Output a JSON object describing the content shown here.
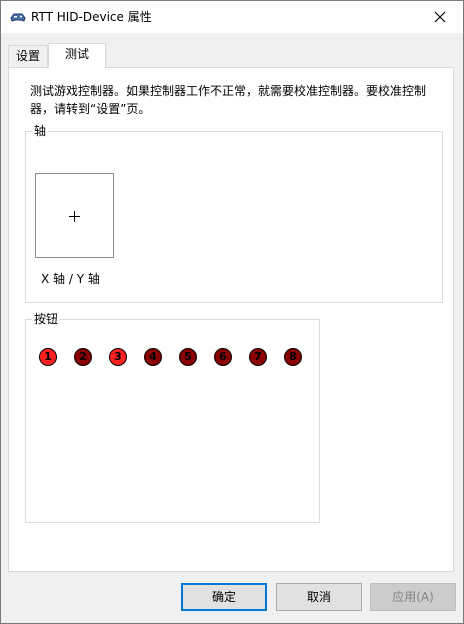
{
  "window": {
    "title": "RTT HID-Device 属性"
  },
  "tabs": [
    {
      "label": "设置",
      "active": false
    },
    {
      "label": "测试",
      "active": true
    }
  ],
  "panel": {
    "intro_text": "测试游戏控制器。如果控制器工作不正常，就需要校准控制器。要校准控制器，请转到“设置”页。",
    "axis_group": {
      "label": "轴",
      "caption": "X 轴 / Y 轴"
    },
    "buttons_group": {
      "label": "按钮",
      "buttons": [
        {
          "number": "1",
          "pressed": true
        },
        {
          "number": "2",
          "pressed": false
        },
        {
          "number": "3",
          "pressed": true
        },
        {
          "number": "4",
          "pressed": false
        },
        {
          "number": "5",
          "pressed": false
        },
        {
          "number": "6",
          "pressed": false
        },
        {
          "number": "7",
          "pressed": false
        },
        {
          "number": "8",
          "pressed": false
        }
      ]
    }
  },
  "footer": {
    "ok_label": "确定",
    "cancel_label": "取消",
    "apply_label": "应用(A)"
  },
  "colors": {
    "accent": "#0078d7",
    "button_pressed": "#ff2020",
    "button_released": "#8b0000"
  }
}
